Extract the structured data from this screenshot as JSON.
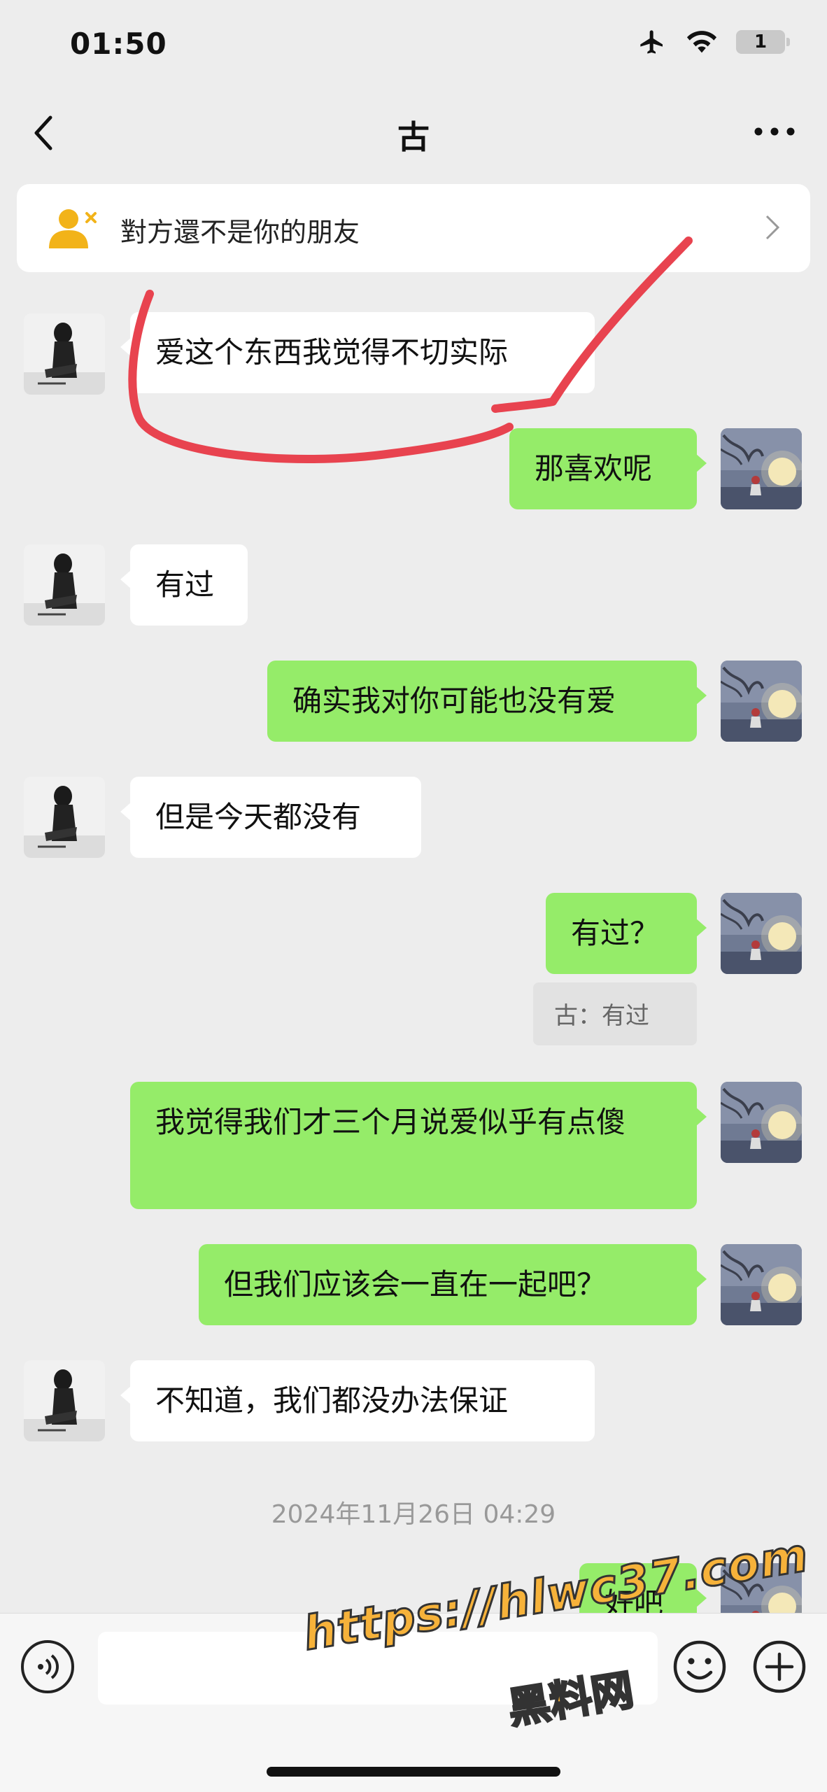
{
  "status_bar": {
    "time": "01:50",
    "battery_level": "1",
    "icons": [
      "airplane-icon",
      "wifi-icon",
      "battery-icon"
    ]
  },
  "nav": {
    "title": "古"
  },
  "banner": {
    "text": "對方還不是你的朋友"
  },
  "messages": [
    {
      "side": "in",
      "text": "爱这个东西我觉得不切实际"
    },
    {
      "side": "out",
      "text": "那喜欢呢"
    },
    {
      "side": "in",
      "text": "有过"
    },
    {
      "side": "out",
      "text": "确实我对你可能也没有爱"
    },
    {
      "side": "in",
      "text": "但是今天都没有"
    },
    {
      "side": "out",
      "text": "有过？",
      "quote": "古：有过"
    },
    {
      "side": "out",
      "text": "我觉得我们才三个月说爱似乎有点傻"
    },
    {
      "side": "out",
      "text": "但我们应该会一直在一起吧？"
    },
    {
      "side": "in",
      "text": "不知道，我们都没办法保证"
    },
    {
      "side": "out",
      "text": "好吧"
    }
  ],
  "datestamp": "2024年11月26日 04:29",
  "watermark": {
    "url": "https://hlwc37.com",
    "name": "黑料网"
  },
  "colors": {
    "outgoing_bubble": "#95ec69",
    "incoming_bubble": "#ffffff",
    "background": "#ededed",
    "annotation": "#e8434f",
    "watermark": "#f6b23a"
  }
}
